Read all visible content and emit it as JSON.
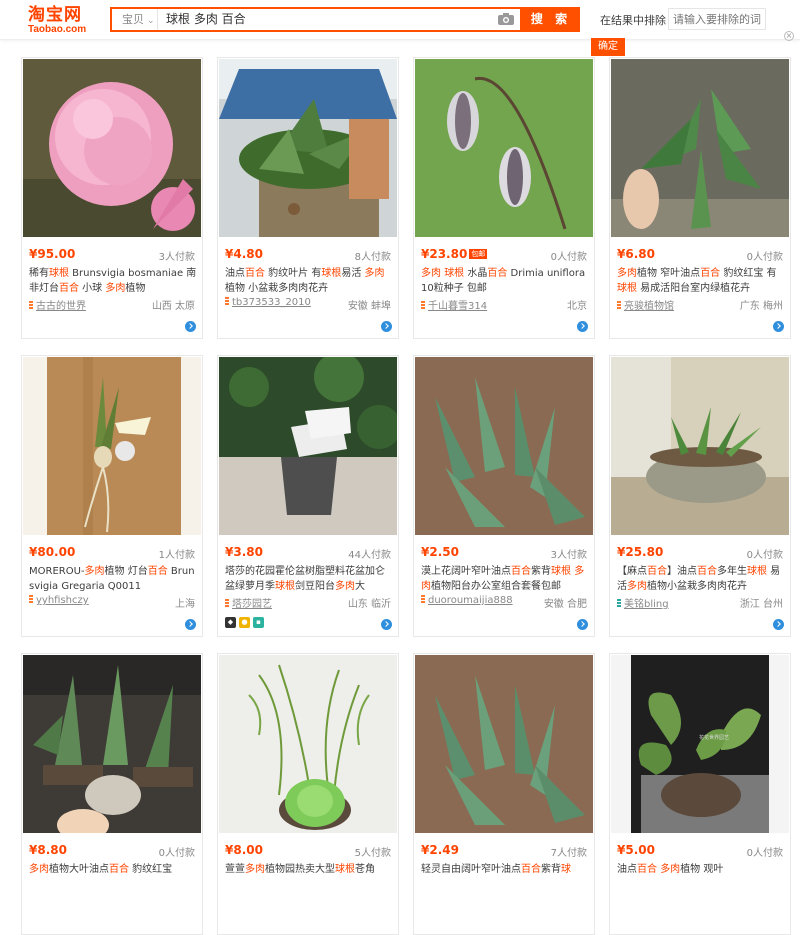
{
  "header": {
    "logo_text": "淘宝网",
    "logo_sub": "Taobao.com",
    "search_category": "宝贝",
    "search_query": "球根 多肉 百合",
    "search_button": "搜 索",
    "exclude_label": "在结果中排除",
    "exclude_placeholder": "请输入要排除的词",
    "confirm_button": "确定"
  },
  "products": [
    {
      "price": "¥95.00",
      "sales": "3人付款",
      "title_parts": [
        [
          "稀有",
          0
        ],
        [
          "球根",
          1
        ],
        [
          " Brunsvigia bosmaniae 南非灯台",
          0
        ],
        [
          "百合",
          1
        ],
        [
          " 小球 ",
          0
        ],
        [
          "多肉",
          1
        ],
        [
          "植物",
          0
        ]
      ],
      "shop": "古古的世界",
      "location": "山西 太原"
    },
    {
      "price": "¥4.80",
      "sales": "8人付款",
      "title_parts": [
        [
          "油点",
          0
        ],
        [
          "百合",
          1
        ],
        [
          " 豹纹叶片 有",
          0
        ],
        [
          "球根",
          1
        ],
        [
          "易活 ",
          0
        ],
        [
          "多肉",
          1
        ],
        [
          "植物 小盆栽多肉肉花卉",
          0
        ]
      ],
      "shop": "tb373533_2010",
      "location": "安徽 蚌埠"
    },
    {
      "price": "¥23.80",
      "sales": "0人付款",
      "title_parts": [
        [
          "多肉",
          1
        ],
        [
          " ",
          0
        ],
        [
          "球根",
          1
        ],
        [
          " 水晶",
          0
        ],
        [
          "百合",
          1
        ],
        [
          " Drimia uniflora 10粒种子 包邮",
          0
        ]
      ],
      "shop": "千山暮雪314",
      "location": "北京"
    },
    {
      "price": "¥6.80",
      "sales": "0人付款",
      "title_parts": [
        [
          "多肉",
          1
        ],
        [
          "植物 窄叶油点",
          0
        ],
        [
          "百合",
          1
        ],
        [
          " 豹纹红宝 有",
          0
        ],
        [
          "球根",
          1
        ],
        [
          " 易成活阳台室内绿植花卉",
          0
        ]
      ],
      "shop": "亮骏植物馆",
      "location": "广东 梅州"
    },
    {
      "price": "¥80.00",
      "sales": "1人付款",
      "title_parts": [
        [
          "MOREROU-",
          0
        ],
        [
          "多肉",
          1
        ],
        [
          "植物 灯台",
          0
        ],
        [
          "百合",
          1
        ],
        [
          " Brunsvigia Gregaria Q0011",
          0
        ]
      ],
      "shop": "yyhfishczy",
      "location": "上海"
    },
    {
      "price": "¥3.80",
      "sales": "44人付款",
      "title_parts": [
        [
          "塔莎的花园霍伦盆树脂塑料花盆加仑盆绿萝月季",
          0
        ],
        [
          "球根",
          1
        ],
        [
          "剑豆阳台",
          0
        ],
        [
          "多肉",
          1
        ],
        [
          "大",
          0
        ]
      ],
      "shop": "塔莎园艺",
      "location": "山东 临沂"
    },
    {
      "price": "¥2.50",
      "sales": "3人付款",
      "title_parts": [
        [
          "漠上花阔叶窄叶油点",
          0
        ],
        [
          "百合",
          1
        ],
        [
          "紫背",
          0
        ],
        [
          "球根",
          1
        ],
        [
          " ",
          0
        ],
        [
          "多肉",
          1
        ],
        [
          "植物阳台办公室组合套餐包邮",
          0
        ]
      ],
      "shop": "duoroumaijia888",
      "location": "安徽 合肥"
    },
    {
      "price": "¥25.80",
      "sales": "0人付款",
      "title_parts": [
        [
          "【麻点",
          0
        ],
        [
          "百合",
          1
        ],
        [
          "】油点",
          0
        ],
        [
          "百合",
          1
        ],
        [
          "多年生",
          0
        ],
        [
          "球根",
          1
        ],
        [
          " 易活",
          0
        ],
        [
          "多肉",
          1
        ],
        [
          "植物小盆栽多肉肉花卉",
          0
        ]
      ],
      "shop": "美铭bling",
      "location": "浙江 台州"
    },
    {
      "price": "¥8.80",
      "sales": "0人付款",
      "title_parts": [
        [
          "多肉",
          1
        ],
        [
          "植物大叶油点",
          0
        ],
        [
          "百合",
          1
        ],
        [
          " 豹纹红宝",
          0
        ]
      ],
      "shop": "",
      "location": ""
    },
    {
      "price": "¥8.00",
      "sales": "5人付款",
      "title_parts": [
        [
          "萱萱",
          0
        ],
        [
          "多肉",
          1
        ],
        [
          "植物园热卖大型",
          0
        ],
        [
          "球根",
          1
        ],
        [
          "苍角",
          0
        ]
      ],
      "shop": "",
      "location": ""
    },
    {
      "price": "¥2.49",
      "sales": "7人付款",
      "title_parts": [
        [
          "轻灵自由阔叶窄叶油点",
          0
        ],
        [
          "百合",
          1
        ],
        [
          "紫背",
          0
        ],
        [
          "球",
          1
        ]
      ],
      "shop": "",
      "location": ""
    },
    {
      "price": "¥5.00",
      "sales": "0人付款",
      "title_parts": [
        [
          "油点",
          0
        ],
        [
          "百合",
          1
        ],
        [
          " ",
          0
        ],
        [
          "多肉",
          1
        ],
        [
          "植物 观叶",
          0
        ]
      ],
      "shop": "",
      "location": ""
    }
  ],
  "price_badge": "包邮",
  "watermark_text": "花花世界园艺"
}
